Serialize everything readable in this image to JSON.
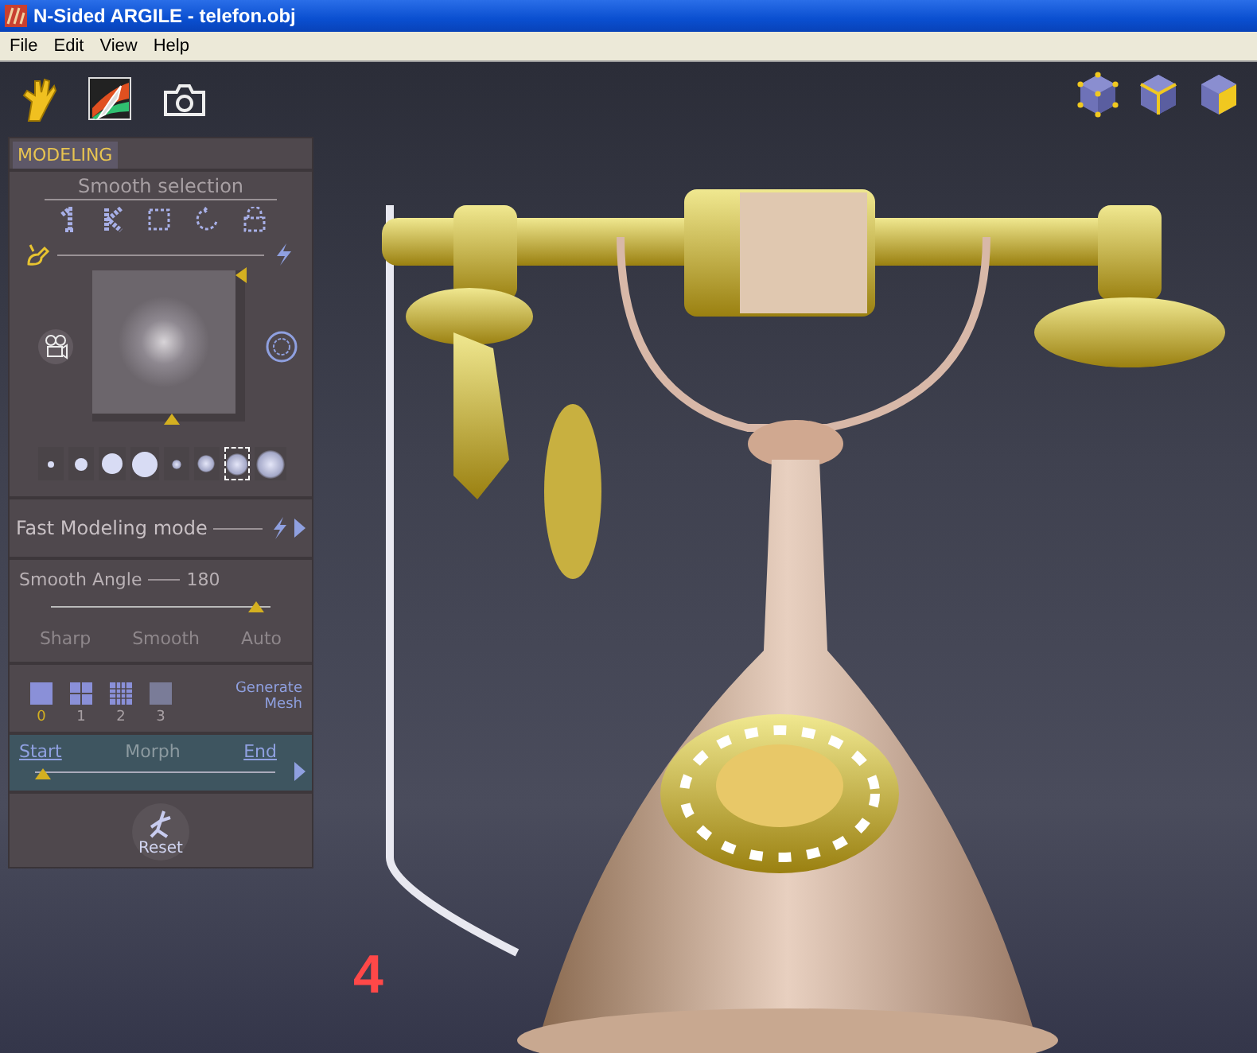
{
  "window": {
    "title": "N-Sided ARGILE - telefon.obj"
  },
  "menu": [
    "File",
    "Edit",
    "View",
    "Help"
  ],
  "panel": {
    "title": "MODELING",
    "smooth_selection": {
      "title": "Smooth selection",
      "strength": {
        "level": 0.55
      },
      "falloff": {
        "level": 0.97
      },
      "brushes": [
        {
          "kind": "hard",
          "selected": false
        },
        {
          "kind": "hard",
          "selected": false
        },
        {
          "kind": "hard",
          "selected": false
        },
        {
          "kind": "hard",
          "selected": false
        },
        {
          "kind": "soft",
          "selected": false
        },
        {
          "kind": "soft",
          "selected": false
        },
        {
          "kind": "soft",
          "selected": true
        },
        {
          "kind": "soft",
          "selected": false
        }
      ]
    },
    "fast_modeling": {
      "label": "Fast Modeling mode"
    },
    "smooth_angle": {
      "label": "Smooth Angle",
      "value": "180",
      "level": 0.97,
      "options": [
        "Sharp",
        "Smooth",
        "Auto"
      ]
    },
    "mesh": {
      "levels": [
        {
          "label": "0",
          "selected": true
        },
        {
          "label": "1",
          "selected": false
        },
        {
          "label": "2",
          "selected": false
        },
        {
          "label": "3",
          "selected": false
        }
      ],
      "generate": "Generate Mesh"
    },
    "morph": {
      "start": "Start",
      "label": "Morph",
      "end": "End",
      "level": 0
    },
    "reset": "Reset"
  },
  "viewport": {
    "figure_label": "4"
  }
}
